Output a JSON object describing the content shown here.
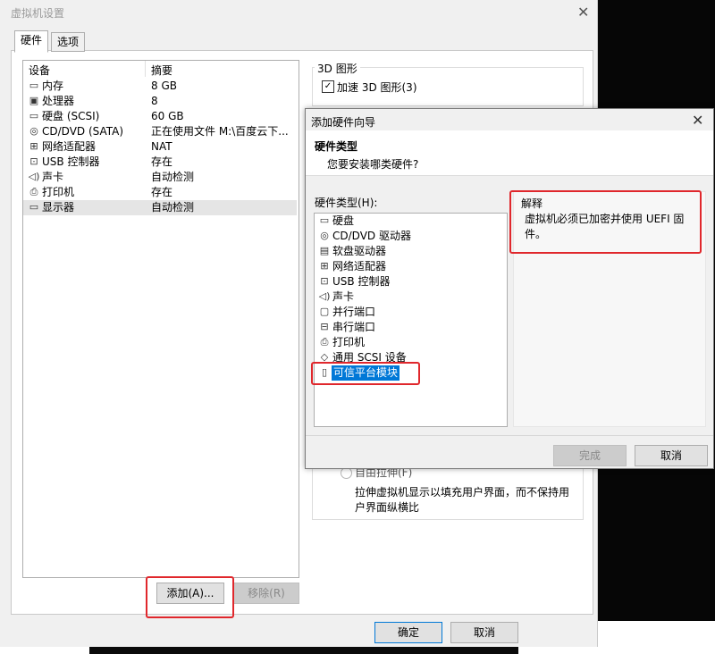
{
  "window": {
    "title": "虚拟机设置",
    "tabs": [
      {
        "label": "硬件"
      },
      {
        "label": "选项"
      }
    ],
    "device_list": {
      "headers": {
        "device": "设备",
        "summary": "摘要"
      },
      "items": [
        {
          "name": "内存",
          "summary": "8 GB",
          "icon": "memory-icon"
        },
        {
          "name": "处理器",
          "summary": "8",
          "icon": "cpu-icon"
        },
        {
          "name": "硬盘 (SCSI)",
          "summary": "60 GB",
          "icon": "harddisk-icon"
        },
        {
          "name": "CD/DVD (SATA)",
          "summary": "正在使用文件 M:\\百度云下...",
          "icon": "cd-icon"
        },
        {
          "name": "网络适配器",
          "summary": "NAT",
          "icon": "network-icon"
        },
        {
          "name": "USB 控制器",
          "summary": "存在",
          "icon": "usb-icon"
        },
        {
          "name": "声卡",
          "summary": "自动检测",
          "icon": "sound-icon"
        },
        {
          "name": "打印机",
          "summary": "存在",
          "icon": "printer-icon"
        },
        {
          "name": "显示器",
          "summary": "自动检测",
          "icon": "display-icon",
          "selected": true
        }
      ]
    },
    "add_button": "添加(A)...",
    "remove_button": "移除(R)",
    "ok_button": "确定",
    "cancel_button": "取消",
    "graphics_group": {
      "title": "3D 图形",
      "accel_label": "加速 3D 图形(3)",
      "accel_checked": true
    },
    "stretch": {
      "option_label": "自由拉伸(F)",
      "description": "拉伸虚拟机显示以填充用户界面，而不保持用户界面纵横比"
    }
  },
  "dialog": {
    "title": "添加硬件向导",
    "header_title": "硬件类型",
    "header_subtitle": "您要安装哪类硬件?",
    "list_label": "硬件类型(H):",
    "items": [
      {
        "name": "硬盘",
        "icon": "harddisk-icon"
      },
      {
        "name": "CD/DVD 驱动器",
        "icon": "cd-icon"
      },
      {
        "name": "软盘驱动器",
        "icon": "floppy-icon"
      },
      {
        "name": "网络适配器",
        "icon": "network-icon"
      },
      {
        "name": "USB 控制器",
        "icon": "usb-icon"
      },
      {
        "name": "声卡",
        "icon": "sound-icon"
      },
      {
        "name": "并行端口",
        "icon": "parallel-port-icon"
      },
      {
        "name": "串行端口",
        "icon": "serial-port-icon"
      },
      {
        "name": "打印机",
        "icon": "printer-icon"
      },
      {
        "name": "通用 SCSI 设备",
        "icon": "scsi-icon"
      },
      {
        "name": "可信平台模块",
        "icon": "tpm-icon",
        "selected": true
      }
    ],
    "explanation_title": "解释",
    "explanation_text": "虚拟机必须已加密并使用 UEFI 固件。",
    "finish_button": "完成",
    "cancel_button": "取消"
  },
  "annotation_color": "#e0272c",
  "selection_color": "#0078d7"
}
